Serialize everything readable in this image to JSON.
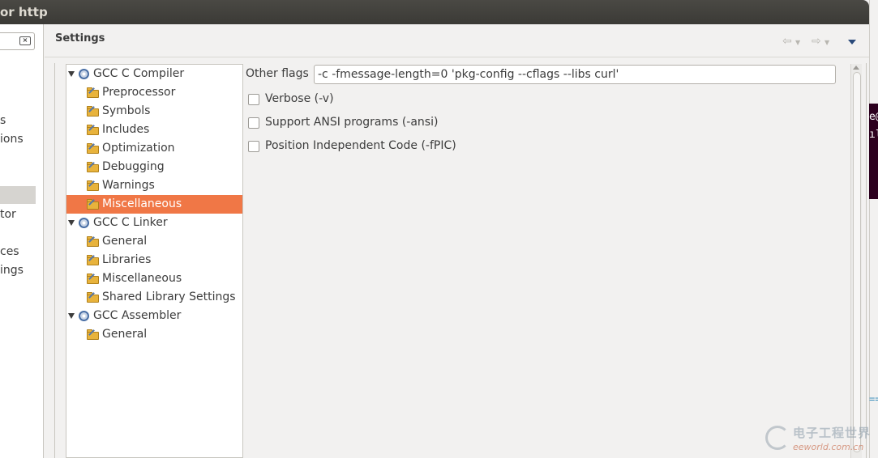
{
  "window": {
    "title": "or http"
  },
  "left_panel": {
    "items": [
      {
        "label": "s",
        "top": 0
      },
      {
        "label": "ions",
        "top": 0
      },
      {
        "label": "tor",
        "top": 0
      },
      {
        "label": "ces",
        "top": 0
      },
      {
        "label": "ings",
        "top": 0
      }
    ]
  },
  "header": {
    "title": "Settings"
  },
  "tree": {
    "rows": [
      {
        "label": "GCC C Compiler",
        "kind": "tool",
        "expanded": true
      },
      {
        "label": "Preprocessor",
        "kind": "category"
      },
      {
        "label": "Symbols",
        "kind": "category"
      },
      {
        "label": "Includes",
        "kind": "category"
      },
      {
        "label": "Optimization",
        "kind": "category"
      },
      {
        "label": "Debugging",
        "kind": "category"
      },
      {
        "label": "Warnings",
        "kind": "category"
      },
      {
        "label": "Miscellaneous",
        "kind": "category",
        "selected": true
      },
      {
        "label": "GCC C Linker",
        "kind": "tool",
        "expanded": true
      },
      {
        "label": "General",
        "kind": "category"
      },
      {
        "label": "Libraries",
        "kind": "category"
      },
      {
        "label": "Miscellaneous",
        "kind": "category"
      },
      {
        "label": "Shared Library Settings",
        "kind": "category"
      },
      {
        "label": "GCC Assembler",
        "kind": "tool",
        "expanded": true
      },
      {
        "label": "General",
        "kind": "category"
      }
    ]
  },
  "options": {
    "other_flags_label": "Other flags",
    "other_flags_value": "-c -fmessage-length=0 'pkg-config --cflags --libs curl'",
    "checkboxes": [
      {
        "label": "Verbose (-v)",
        "checked": false
      },
      {
        "label": "Support ANSI programs (-ansi)",
        "checked": false
      },
      {
        "label": "Position Independent Code (-fPIC)",
        "checked": false
      }
    ]
  },
  "right_strip": {
    "terminal_text": "e@ ıl",
    "equals": "=="
  },
  "watermark": {
    "cn": "电子工程世界",
    "en": "eeworld.com.cn"
  },
  "colors": {
    "selection": "#f07746",
    "titlebar": "#3b3a36",
    "terminal": "#2c001e"
  }
}
